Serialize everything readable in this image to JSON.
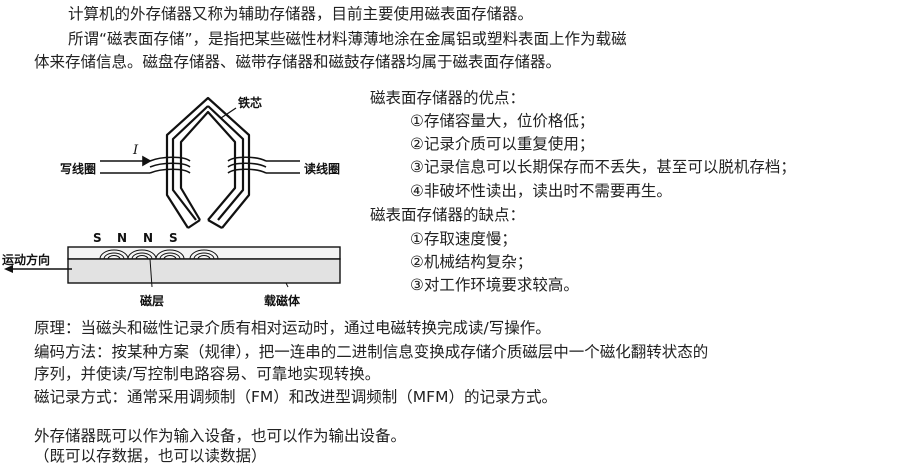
{
  "intro": {
    "line1": "计算机的外存储器又称为辅助存储器，目前主要使用磁表面存储器。",
    "line2": "所谓“磁表面存储”，是指把某些磁性材料薄薄地涂在金属铝或塑料表面上作为载磁",
    "line3": "体来存储信息。磁盘存储器、磁带存储器和磁鼓存储器均属于磁表面存储器。"
  },
  "figure": {
    "core_label": "铁芯",
    "current_label": "I",
    "write_coil_label": "写线圈",
    "read_coil_label": "读线圈",
    "poles": [
      "S",
      "N",
      "N",
      "S"
    ],
    "motion_label": "运动方向",
    "layer_label": "磁层",
    "carrier_label": "载磁体"
  },
  "advantages": {
    "heading": "磁表面存储器的优点：",
    "items": [
      "①存储容量大，位价格低；",
      "②记录介质可以重复使用；",
      "③记录信息可以长期保存而不丢失，甚至可以脱机存档；",
      "④非破坏性读出，读出时不需要再生。"
    ]
  },
  "disadvantages": {
    "heading": "磁表面存储器的缺点：",
    "items": [
      "①存取速度慢；",
      "②机械结构复杂；",
      "③对工作环境要求较高。"
    ]
  },
  "body": {
    "principle": "原理：当磁头和磁性记录介质有相对运动时，通过电磁转换完成读/写操作。",
    "encoding_1": "编码方法：按某种方案（规律），把一连串的二进制信息变换成存储介质磁层中一个磁化翻转状态的",
    "encoding_2": "序列，并使读/写控制电路容易、可靠地实现转换。",
    "recording": "磁记录方式：通常采用调频制（FM）和改进型调频制（MFM）的记录方式。",
    "io_1": "外存储器既可以作为输入设备，也可以作为输出设备。",
    "io_2": "（既可以存数据，也可以读数据）"
  }
}
